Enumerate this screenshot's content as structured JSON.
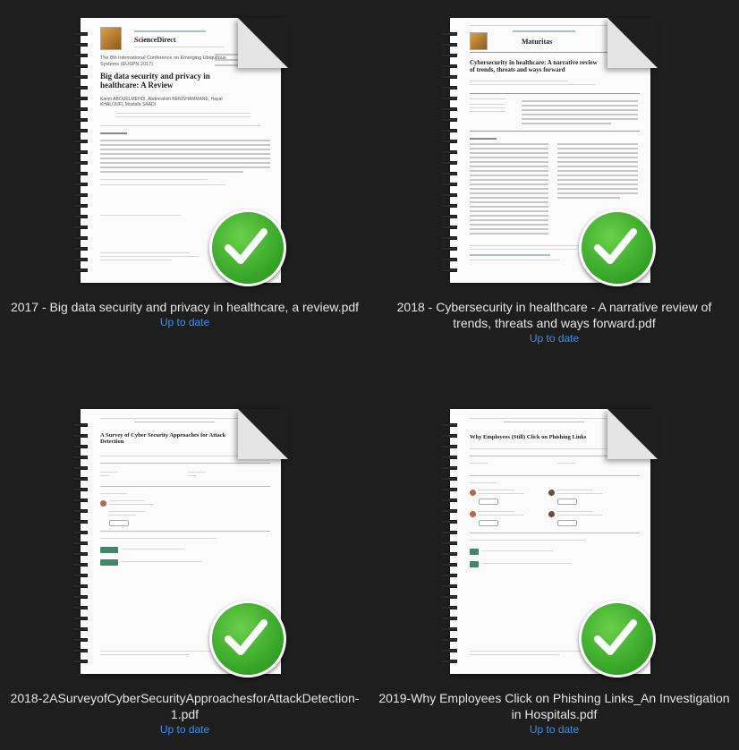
{
  "files": [
    {
      "name": "2017 - Big data security and privacy in healthcare, a review.pdf",
      "status": "Up to date",
      "thumb_heading": "ScienceDirect",
      "thumb_title": "Big data security and privacy in healthcare: A Review",
      "thumb_conf": "The 8th International Conference on Emerging Ubiquitous Systems (EUSPN 2017)",
      "thumb_authors": "Karim ABOUELMEHDI, Abderrahim BENISHAMMANE, Hayat KHALOUFI, Mostafa SAADI"
    },
    {
      "name": "2018 - Cybersecurity in healthcare - A narrative review of trends, threats and ways forward.pdf",
      "status": "Up to date",
      "thumb_heading": "Maturitas",
      "thumb_title": "Cybersecurity in healthcare: A narrative review of trends, threats and ways forward"
    },
    {
      "name": "2018-2ASurveyofCyberSecurityApproachesforAttackDetection-1.pdf",
      "status": "Up to date",
      "thumb_title": "A Survey of Cyber Security Approaches for Attack Detection"
    },
    {
      "name": "2019-Why Employees Click on Phishing Links_An Investigation in Hospitals.pdf",
      "status": "Up to date",
      "thumb_title": "Why Employees (Still) Click on Phishing Links"
    }
  ],
  "colors": {
    "background": "#1e1e1e",
    "caption_text": "#e6e6e6",
    "status_text": "#3b8ff0",
    "badge_green": "#3aa82a"
  },
  "icons": {
    "sync_status": "checkmark-badge-icon",
    "binding": "spiral-binding-icon"
  }
}
